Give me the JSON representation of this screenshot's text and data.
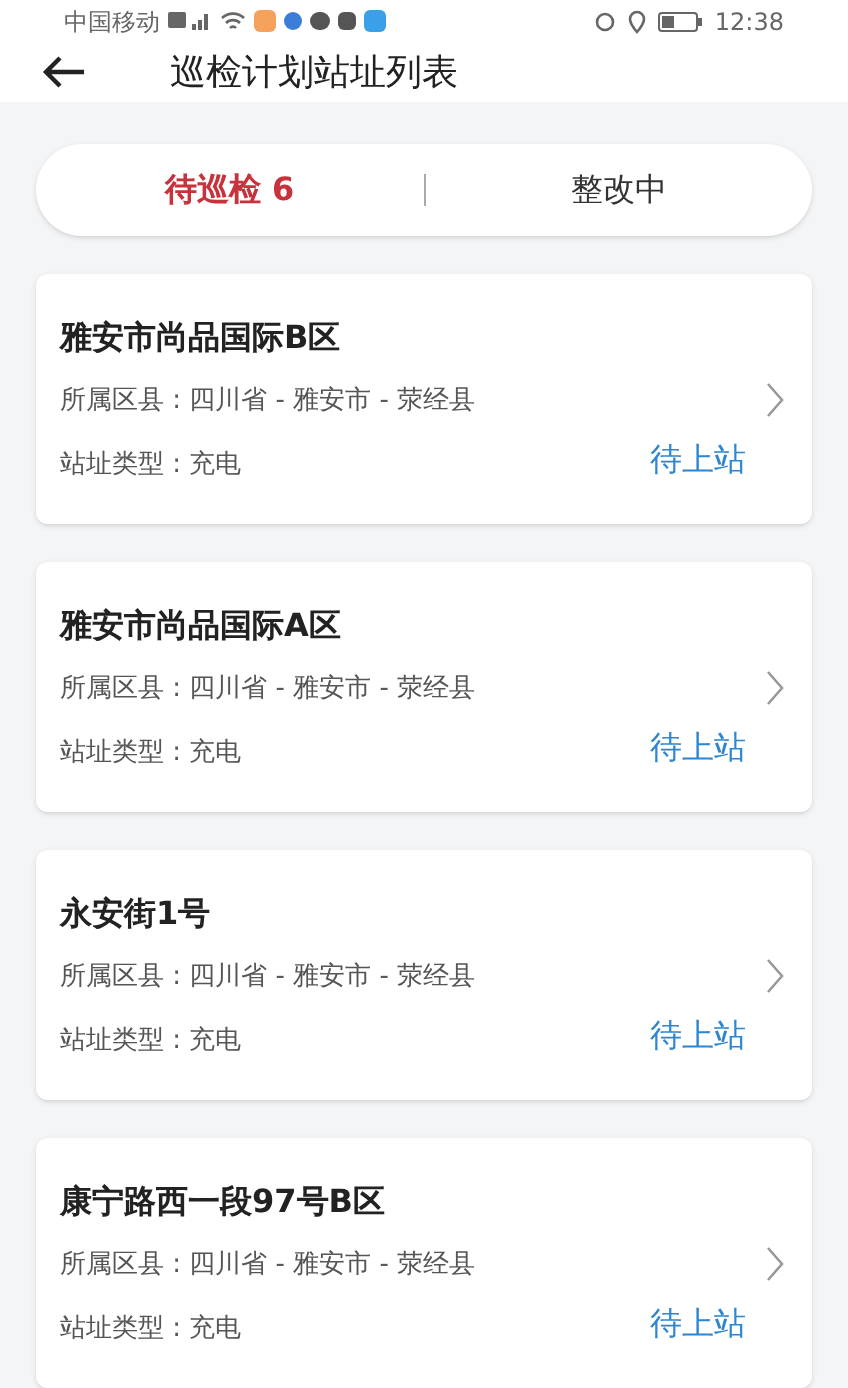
{
  "status_bar": {
    "carrier": "中国移动",
    "time": "12:38"
  },
  "header": {
    "title": "巡检计划站址列表"
  },
  "tabs": [
    {
      "label": "待巡检 6",
      "selected": true
    },
    {
      "label": "整改中",
      "selected": false
    }
  ],
  "sites": [
    {
      "name": "雅安市尚品国际B区",
      "district": "所属区县 : 四川省 - 雅安市 - 荥经县",
      "type": "站址类型 : 充电",
      "status": "待上站"
    },
    {
      "name": "雅安市尚品国际A区",
      "district": "所属区县 : 四川省 - 雅安市 - 荥经县",
      "type": "站址类型 : 充电",
      "status": "待上站"
    },
    {
      "name": "永安街1号",
      "district": "所属区县 : 四川省 - 雅安市 - 荥经县",
      "type": "站址类型 : 充电",
      "status": "待上站"
    },
    {
      "name": "康宁路西一段97号B区",
      "district": "所属区县 : 四川省 - 雅安市 - 荥经县",
      "type": "站址类型 : 充电",
      "status": "待上站"
    }
  ]
}
